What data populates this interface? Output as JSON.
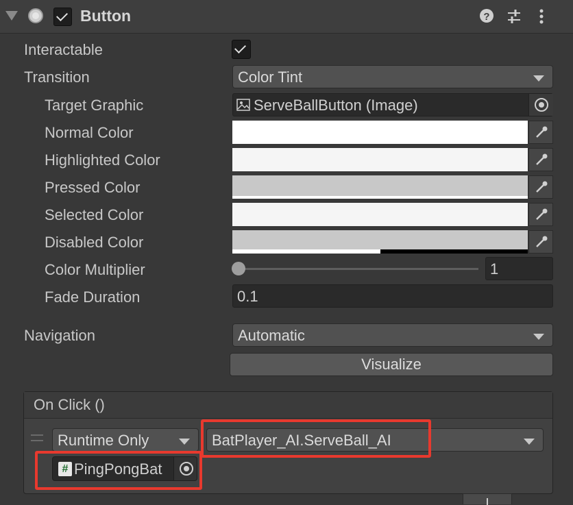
{
  "header": {
    "title": "Button",
    "enabled": true,
    "icons": [
      "fold-arrow-icon",
      "component-icon",
      "help-icon",
      "preset-icon",
      "more-menu-icon"
    ]
  },
  "properties": {
    "interactable": {
      "label": "Interactable",
      "checked": true
    },
    "transition": {
      "label": "Transition",
      "value": "Color Tint"
    },
    "target_graphic": {
      "label": "Target Graphic",
      "value": "ServeBallButton (Image)"
    },
    "normal_color": {
      "label": "Normal Color",
      "color": "#FFFFFF"
    },
    "highlighted_color": {
      "label": "Highlighted Color",
      "color": "#F5F5F5"
    },
    "pressed_color": {
      "label": "Pressed Color",
      "color": "#C8C8C8"
    },
    "selected_color": {
      "label": "Selected Color",
      "color": "#F5F5F5"
    },
    "disabled_color": {
      "label": "Disabled Color",
      "color": "#C8C8C8",
      "alpha": 0.5
    },
    "color_multiplier": {
      "label": "Color Multiplier",
      "value": "1",
      "slider_fraction": 0.0
    },
    "fade_duration": {
      "label": "Fade Duration",
      "value": "0.1"
    },
    "navigation": {
      "label": "Navigation",
      "value": "Automatic"
    },
    "visualize_label": "Visualize"
  },
  "on_click": {
    "title": "On Click ()",
    "runtime": "Runtime Only",
    "function": "BatPlayer_AI.ServeBall_AI",
    "object": "PingPongBat",
    "object_icon": "#"
  },
  "colors": {
    "background": "#383838",
    "highlight_box": "#E8392E"
  }
}
